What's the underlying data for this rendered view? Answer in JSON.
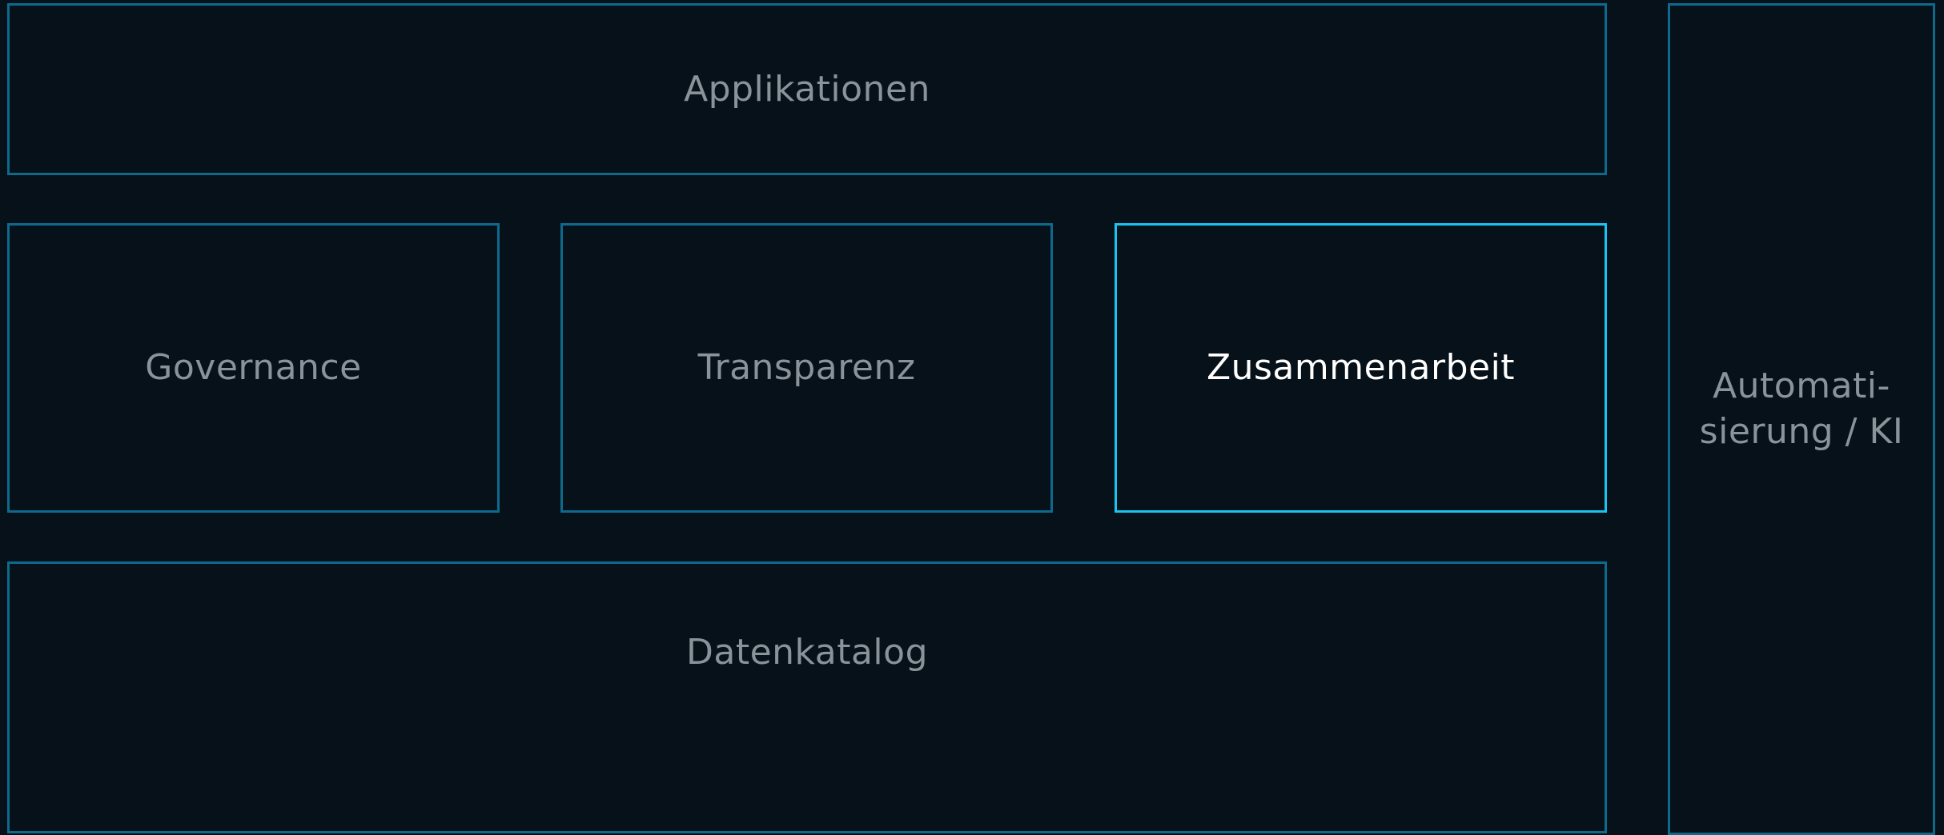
{
  "diagram": {
    "blocks": {
      "applications": {
        "label": "Applikationen"
      },
      "governance": {
        "label": "Governance"
      },
      "transparency": {
        "label": "Transparenz"
      },
      "collaboration": {
        "label": "Zusammenarbeit",
        "highlighted": true
      },
      "data_catalog": {
        "label": "Datenkatalog"
      },
      "automation_ai": {
        "label": "Automati-\nsierung / KI"
      }
    },
    "colors": {
      "background": "#06111a",
      "border": "#0e6a8d",
      "highlight_border": "#1cc3ef",
      "label": "#8a939a",
      "highlight_label": "#ffffff"
    }
  }
}
